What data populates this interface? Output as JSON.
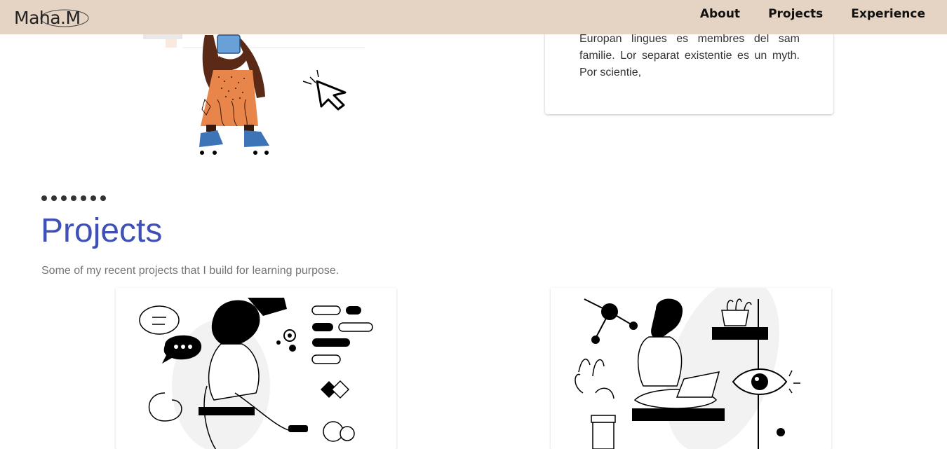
{
  "navbar": {
    "logo_text": "Maha.M",
    "links": [
      {
        "label": "About"
      },
      {
        "label": "Projects"
      },
      {
        "label": "Experience"
      }
    ]
  },
  "about": {
    "text": "Europan lingues es membres del sam familie. Lor separat existentie es un myth. Por scientie,"
  },
  "projects": {
    "title": "Projects",
    "subtitle": "Some of my recent projects that I build for learning purpose."
  },
  "colors": {
    "navbar_bg": "#e5d4c3",
    "title_accent": "#3f51b5"
  }
}
